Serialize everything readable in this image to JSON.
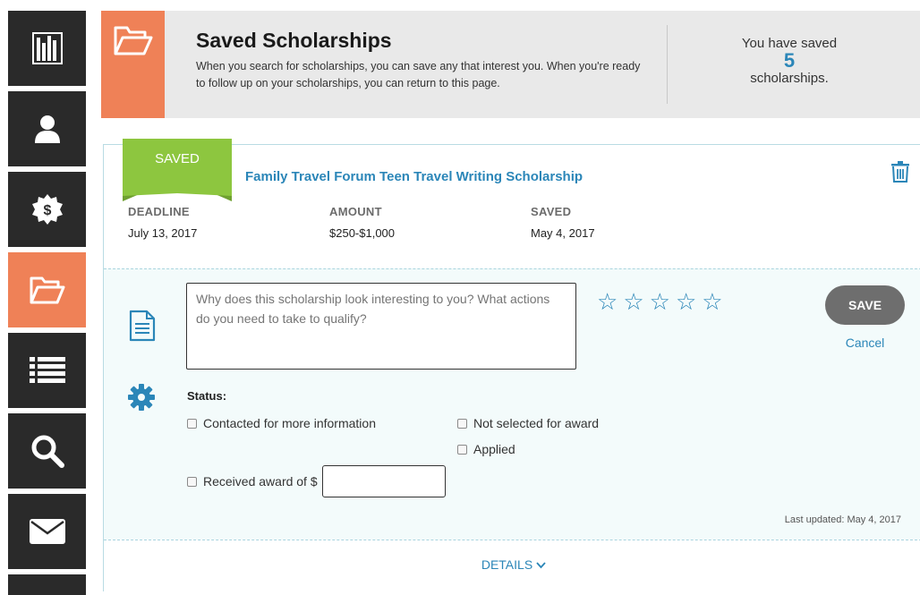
{
  "sidebar": {
    "items": [
      {
        "name": "dashboard",
        "icon": "bar-chart-icon",
        "active": false
      },
      {
        "name": "profile",
        "icon": "user-icon",
        "active": false
      },
      {
        "name": "financial-aid",
        "icon": "dollar-gear-icon",
        "active": false
      },
      {
        "name": "saved",
        "icon": "open-folder-icon",
        "active": true
      },
      {
        "name": "lists",
        "icon": "list-icon",
        "active": false
      },
      {
        "name": "search",
        "icon": "search-icon",
        "active": false
      },
      {
        "name": "messages",
        "icon": "envelope-icon",
        "active": false
      }
    ]
  },
  "header": {
    "title": "Saved Scholarships",
    "description": "When you search for scholarships, you can save any that interest you. When you're ready to follow up on your scholarships, you can return to this page.",
    "stats_prefix": "You have saved",
    "stats_count": "5",
    "stats_suffix": "scholarships."
  },
  "card": {
    "badge": "SAVED",
    "title": "Family Travel Forum Teen Travel Writing Scholarship",
    "deadline_label": "DEADLINE",
    "deadline_value": "July 13, 2017",
    "amount_label": "AMOUNT",
    "amount_value": "$250-$1,000",
    "saved_label": "SAVED",
    "saved_value": "May 4, 2017",
    "notes_placeholder": "Why does this scholarship look interesting to you? What actions do you need to take to qualify?",
    "rating_max": 5,
    "rating_value": 0,
    "save_label": "SAVE",
    "cancel_label": "Cancel",
    "status_label": "Status:",
    "status_options": {
      "contacted": "Contacted for more information",
      "not_selected": "Not selected for award",
      "applied": "Applied",
      "received": "Received award of $"
    },
    "last_updated": "Last updated: May 4, 2017",
    "details_label": "DETAILS"
  },
  "colors": {
    "accent_orange": "#ef8157",
    "link_blue": "#2b86b8",
    "badge_green": "#8dc63f",
    "nav_dark": "#2a2a2a"
  }
}
